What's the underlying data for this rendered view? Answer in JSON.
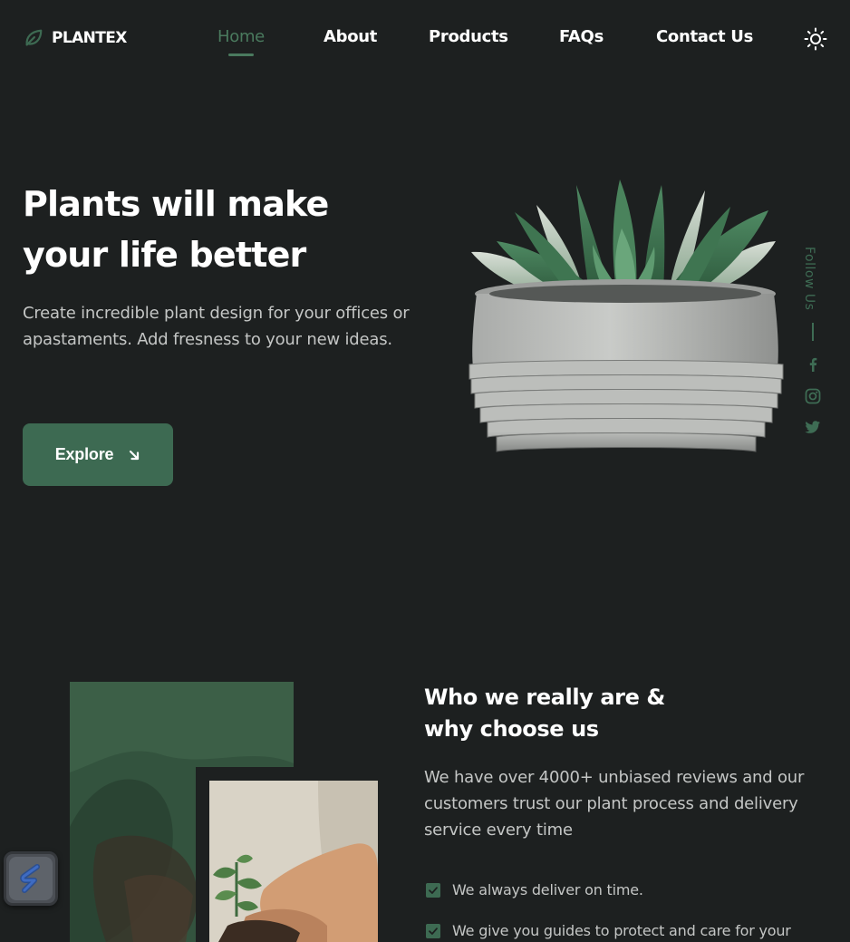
{
  "brand": {
    "name": "PLANTEX"
  },
  "nav": {
    "items": [
      "Home",
      "About",
      "Products",
      "FAQs",
      "Contact Us"
    ],
    "active": "Home"
  },
  "hero": {
    "title_line1": "Plants will make",
    "title_line2": "your life better",
    "description": "Create incredible plant design for your offices or apastaments. Add fresness to your new ideas.",
    "cta_label": "Explore"
  },
  "social": {
    "label": "Follow Us",
    "icons": [
      "facebook-icon",
      "instagram-icon",
      "twitter-icon"
    ]
  },
  "about": {
    "title_line1": "Who we really are &",
    "title_line2": "why choose us",
    "description": "We have over 4000+ unbiased reviews and our customers trust our plant process and delivery service every time",
    "checklist": [
      "We always deliver on time.",
      "We give you guides to protect and care for your"
    ]
  },
  "colors": {
    "background": "#1d2020",
    "accent": "#3d6a52",
    "accent_text": "#4a7a5e",
    "body_text": "#c4c6c5",
    "heading": "#ffffff"
  }
}
